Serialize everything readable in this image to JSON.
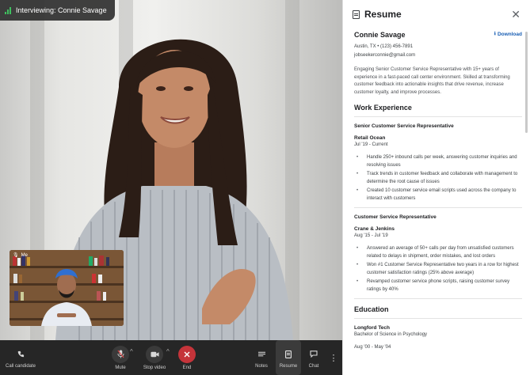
{
  "meeting": {
    "badge_text": "Interviewing: Connie Savage",
    "self_view_label": "Me"
  },
  "controls": {
    "call_candidate": "Call candidate",
    "mute": "Mute",
    "stop_video": "Stop video",
    "end": "End",
    "notes": "Notes",
    "resume": "Resume",
    "chat": "Chat",
    "more_glyph": "⋮",
    "caret": "^"
  },
  "panel": {
    "title": "Resume",
    "close_glyph": "✕",
    "download": "Download",
    "download_glyph": "⭳"
  },
  "resume": {
    "name": "Connie Savage",
    "location_phone": "Austin, TX • (123) 456-7891",
    "email": "jobseekerconnie@gmail.com",
    "summary": "Engaging Senior Customer Service Representative with 15+ years of experience in a fast-paced call center environment. Skilled at transforming customer feedback into actionable insights that drive revenue, increase customer loyalty, and improve processes.",
    "work_heading": "Work Experience",
    "jobs": [
      {
        "title": "Senior Customer Service Representative",
        "company": "Retail Ocean",
        "dates": "Jul '19 - Current",
        "bullets": [
          "Handle 250+ inbound calls per week, answering customer inquiries and resolving issues",
          "Track trends in customer feedback and collaborate with management to determine the root cause of issues",
          "Created 10 customer service email scripts used across the company to interact with customers"
        ]
      },
      {
        "title": "Customer Service Representative",
        "company": "Crane & Jenkins",
        "dates": "Aug '15 - Jul '19",
        "bullets": [
          "Answered an average of 50+ calls per day from unsatisfied customers related to delays in shipment, order mistakes, and lost orders",
          "Won #1 Customer Service Representative two years in a row for highest customer satisfaction ratings (25% above average)",
          "Revamped customer service phone scripts, raising customer survey ratings by 40%"
        ]
      }
    ],
    "education_heading": "Education",
    "school": "Longford Tech",
    "degree": "Bachelor of Science in Psychology",
    "edu_dates": "Aug '00 - May '04"
  }
}
